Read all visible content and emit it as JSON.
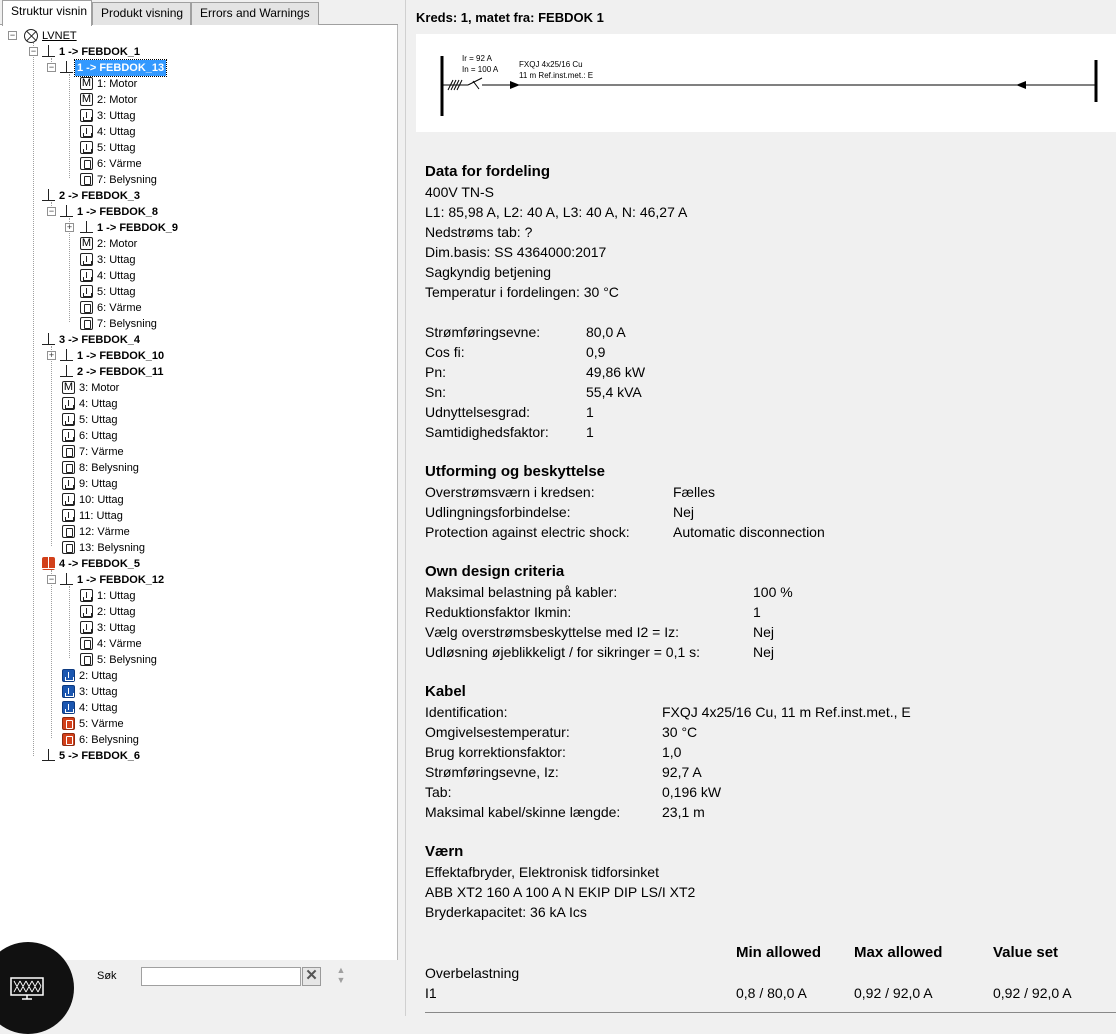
{
  "tabs": [
    "Struktur visnin",
    "Produkt visning",
    "Errors and Warnings"
  ],
  "tree": {
    "root": "LVNET",
    "nodes": [
      {
        "label": "1 -> FEBDOK_1",
        "bold": true
      },
      {
        "label": "1 -> FEBDOK_13",
        "bold": true,
        "selected": true
      },
      {
        "label": "1: Motor"
      },
      {
        "label": "2: Motor"
      },
      {
        "label": "3: Uttag"
      },
      {
        "label": "4: Uttag"
      },
      {
        "label": "5: Uttag"
      },
      {
        "label": "6: Värme"
      },
      {
        "label": "7: Belysning"
      },
      {
        "label": "2 -> FEBDOK_3",
        "bold": true
      },
      {
        "label": "1 -> FEBDOK_8",
        "bold": true
      },
      {
        "label": "1 -> FEBDOK_9",
        "bold": true
      },
      {
        "label": "2: Motor"
      },
      {
        "label": "3: Uttag"
      },
      {
        "label": "4: Uttag"
      },
      {
        "label": "5: Uttag"
      },
      {
        "label": "6: Värme"
      },
      {
        "label": "7: Belysning"
      },
      {
        "label": "3 -> FEBDOK_4",
        "bold": true
      },
      {
        "label": "1 -> FEBDOK_10",
        "bold": true
      },
      {
        "label": "2 -> FEBDOK_11",
        "bold": true
      },
      {
        "label": "3: Motor"
      },
      {
        "label": "4: Uttag"
      },
      {
        "label": "5: Uttag"
      },
      {
        "label": "6: Uttag"
      },
      {
        "label": "7: Värme"
      },
      {
        "label": "8: Belysning"
      },
      {
        "label": "9: Uttag"
      },
      {
        "label": "10: Uttag"
      },
      {
        "label": "11: Uttag"
      },
      {
        "label": "12: Värme"
      },
      {
        "label": "13: Belysning"
      },
      {
        "label": "4 -> FEBDOK_5",
        "bold": true
      },
      {
        "label": "1 -> FEBDOK_12",
        "bold": true
      },
      {
        "label": "1: Uttag"
      },
      {
        "label": "2: Uttag"
      },
      {
        "label": "3: Uttag"
      },
      {
        "label": "4: Värme"
      },
      {
        "label": "5: Belysning"
      },
      {
        "label": "2: Uttag"
      },
      {
        "label": "3: Uttag"
      },
      {
        "label": "4: Uttag"
      },
      {
        "label": "5: Värme"
      },
      {
        "label": "6: Belysning"
      },
      {
        "label": "5 -> FEBDOK_6",
        "bold": true
      }
    ],
    "motor_glyph": "M"
  },
  "search": {
    "label": "Søk",
    "value": "",
    "clear_glyph": "✕",
    "up_glyph": "▲",
    "down_glyph": "▼"
  },
  "circuit": {
    "title": "Kreds: 1, matet fra: FEBDOK  1",
    "diagram": {
      "ir": "Ir = 92 A",
      "in": "In = 100 A",
      "cable": "FXQJ 4x25/16 Cu",
      "length": "11 m   Ref.inst.met.: E"
    }
  },
  "fordeling": {
    "heading": "Data for fordeling",
    "lines": [
      "400V TN-S",
      "L1: 85,98 A, L2: 40 A, L3: 40 A, N: 46,27 A",
      "Nedstrøms tab: ?",
      "Dim.basis: SS 4364000:2017",
      "Sagkyndig betjening",
      "Temperatur i fordelingen: 30 °C"
    ],
    "props": [
      {
        "k": "Strømføringsevne:",
        "v": "80,0 A"
      },
      {
        "k": "Cos fi:",
        "v": "0,9"
      },
      {
        "k": "Pn:",
        "v": "49,86 kW"
      },
      {
        "k": "Sn:",
        "v": "55,4 kVA"
      },
      {
        "k": "Udnyttelsesgrad:",
        "v": "1"
      },
      {
        "k": "Samtidighedsfaktor:",
        "v": "1"
      }
    ]
  },
  "utforming": {
    "heading": "Utforming og beskyttelse",
    "props": [
      {
        "k": "Overstrømsværn i kredsen:",
        "v": "Fælles"
      },
      {
        "k": "Udlingningsforbindelse:",
        "v": "Nej"
      },
      {
        "k": "Protection against electric shock:",
        "v": "Automatic disconnection"
      }
    ]
  },
  "design": {
    "heading": "Own design criteria",
    "props": [
      {
        "k": "Maksimal belastning på kabler:",
        "v": "100 %"
      },
      {
        "k": "Reduktionsfaktor Ikmin:",
        "v": "1"
      },
      {
        "k": "Vælg overstrømsbeskyttelse med I2 = Iz:",
        "v": "Nej"
      },
      {
        "k": "Udløsning øjeblikkeligt / for sikringer = 0,1 s:",
        "v": "Nej"
      }
    ]
  },
  "kabel": {
    "heading": "Kabel",
    "props": [
      {
        "k": "Identification:",
        "v": "FXQJ 4x25/16 Cu, 11 m Ref.inst.met., E"
      },
      {
        "k": "Omgivelsestemperatur:",
        "v": "30 °C"
      },
      {
        "k": "Brug korrektionsfaktor:",
        "v": "1,0"
      },
      {
        "k": "Strømføringsevne, Iz:",
        "v": "92,7 A"
      },
      {
        "k": "Tab:",
        "v": "0,196 kW"
      },
      {
        "k": "Maksimal kabel/skinne længde:",
        "v": "23,1 m"
      }
    ]
  },
  "vaern": {
    "heading": "Værn",
    "lines": [
      "Effektafbryder, Elektronisk tidforsinket",
      "ABB XT2 160 A 100 A N EKIP DIP LS/I XT2",
      "Bryderkapacitet:  36 kA Ics"
    ]
  },
  "settings": {
    "headers": [
      "Min allowed",
      "Max allowed",
      "Value set"
    ],
    "group": "Overbelastning",
    "rows": [
      {
        "name": "I1",
        "min": "0,8 / 80,0 A",
        "max": "0,92 / 92,0 A",
        "set": "0,92 / 92,0 A"
      }
    ]
  }
}
